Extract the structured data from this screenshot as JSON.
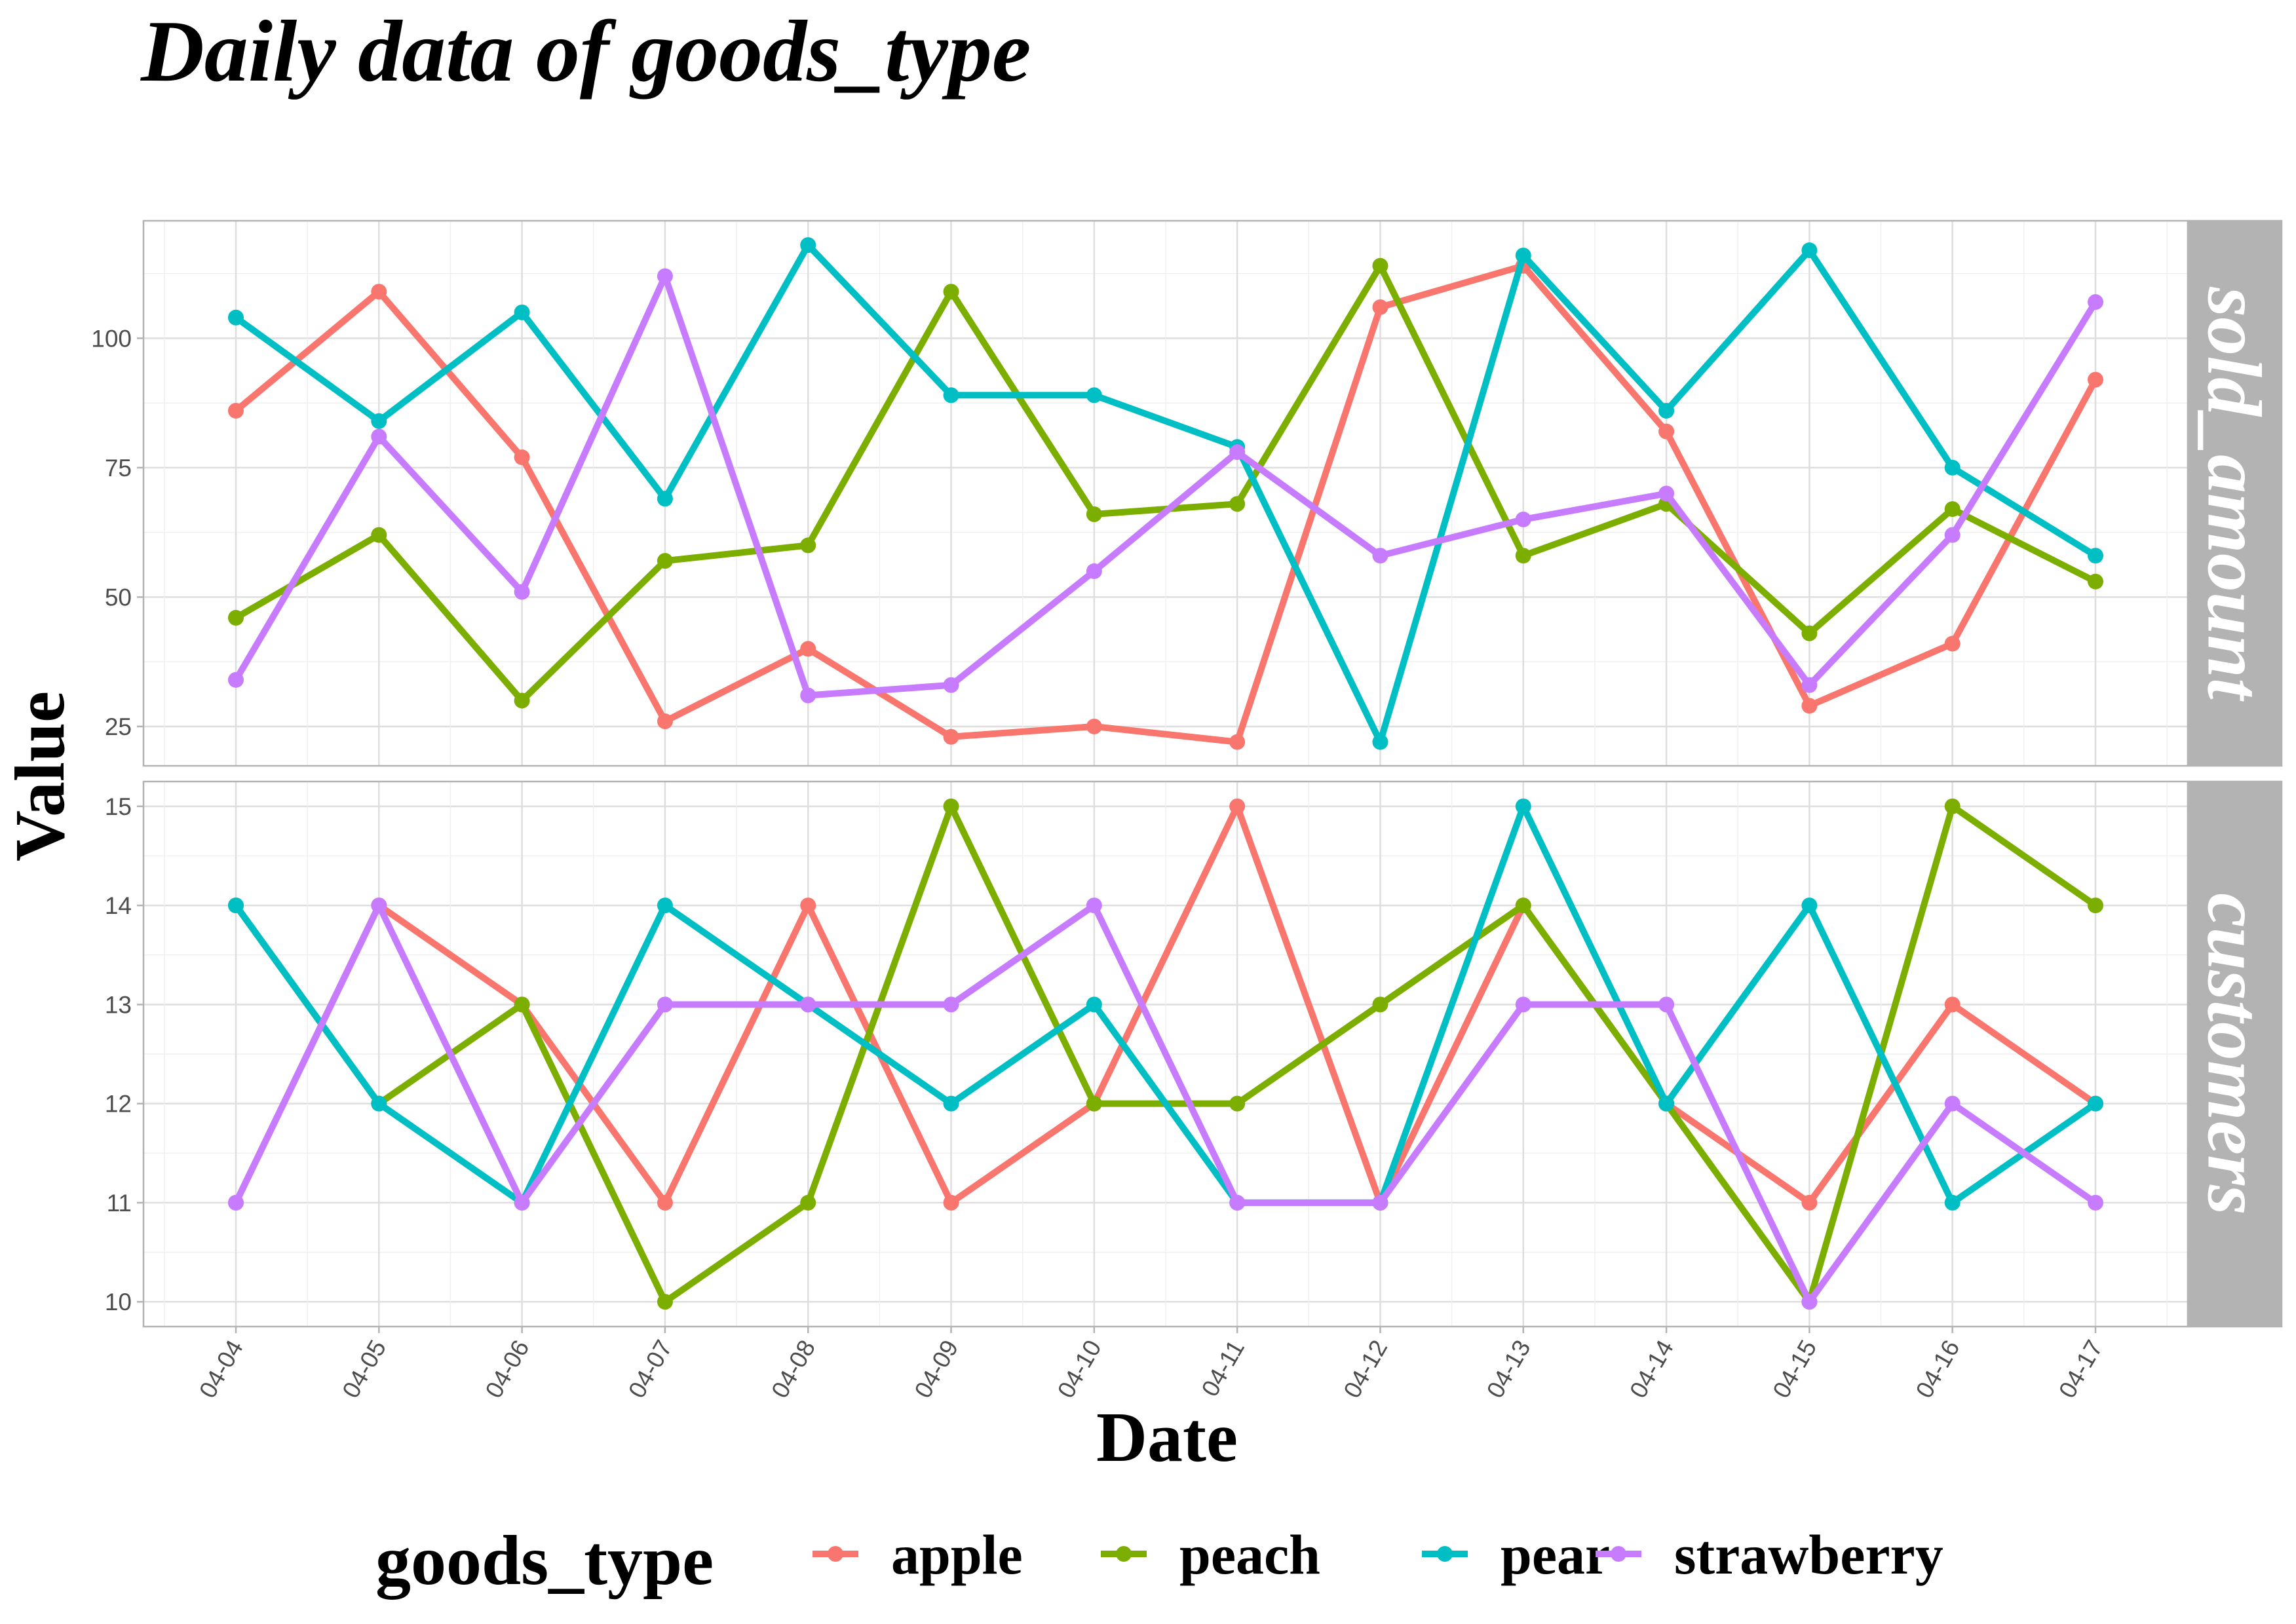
{
  "chart_data": {
    "type": "line",
    "title": "Daily data of goods_type",
    "xlabel": "Date",
    "ylabel": "Value",
    "x": [
      "04-04",
      "04-05",
      "04-06",
      "04-07",
      "04-08",
      "04-09",
      "04-10",
      "04-11",
      "04-12",
      "04-13",
      "04-14",
      "04-15",
      "04-16",
      "04-17"
    ],
    "legend": {
      "title": "goods_type",
      "position": "bottom",
      "entries": [
        "apple",
        "peach",
        "pear",
        "strawberry"
      ]
    },
    "colors": {
      "apple": "#F8766D",
      "peach": "#7CAE00",
      "pear": "#00BFC4",
      "strawberry": "#C77CFF"
    },
    "grid": true,
    "facets": [
      {
        "strip_label": "sold_amount",
        "ylim": [
          17.4,
          122.7
        ],
        "yticks": [
          25,
          50,
          75,
          100
        ],
        "series": [
          {
            "name": "apple",
            "values": [
              86,
              109,
              77,
              26,
              40,
              23,
              25,
              22,
              106,
              114,
              82,
              29,
              41,
              92
            ]
          },
          {
            "name": "peach",
            "values": [
              46,
              62,
              30,
              57,
              60,
              109,
              66,
              68,
              114,
              58,
              68,
              43,
              67,
              53
            ]
          },
          {
            "name": "pear",
            "values": [
              104,
              84,
              105,
              69,
              118,
              89,
              89,
              79,
              22,
              116,
              86,
              117,
              75,
              58
            ]
          },
          {
            "name": "strawberry",
            "values": [
              34,
              81,
              51,
              112,
              31,
              33,
              55,
              78,
              58,
              65,
              70,
              33,
              62,
              107
            ]
          }
        ]
      },
      {
        "strip_label": "customers",
        "ylim": [
          9.75,
          15.25
        ],
        "yticks": [
          10,
          11,
          12,
          13,
          14,
          15
        ],
        "series": [
          {
            "name": "apple",
            "values": [
              11,
              14,
              13,
              11,
              14,
              11,
              12,
              15,
              11,
              14,
              12,
              11,
              13,
              12
            ]
          },
          {
            "name": "peach",
            "values": [
              14,
              12,
              13,
              10,
              11,
              15,
              12,
              12,
              13,
              14,
              12,
              10,
              15,
              14
            ]
          },
          {
            "name": "pear",
            "values": [
              14,
              12,
              11,
              14,
              13,
              12,
              13,
              11,
              11,
              15,
              12,
              14,
              11,
              12
            ]
          },
          {
            "name": "strawberry",
            "values": [
              11,
              14,
              11,
              13,
              13,
              13,
              14,
              11,
              11,
              13,
              13,
              10,
              12,
              11
            ]
          }
        ]
      }
    ]
  }
}
